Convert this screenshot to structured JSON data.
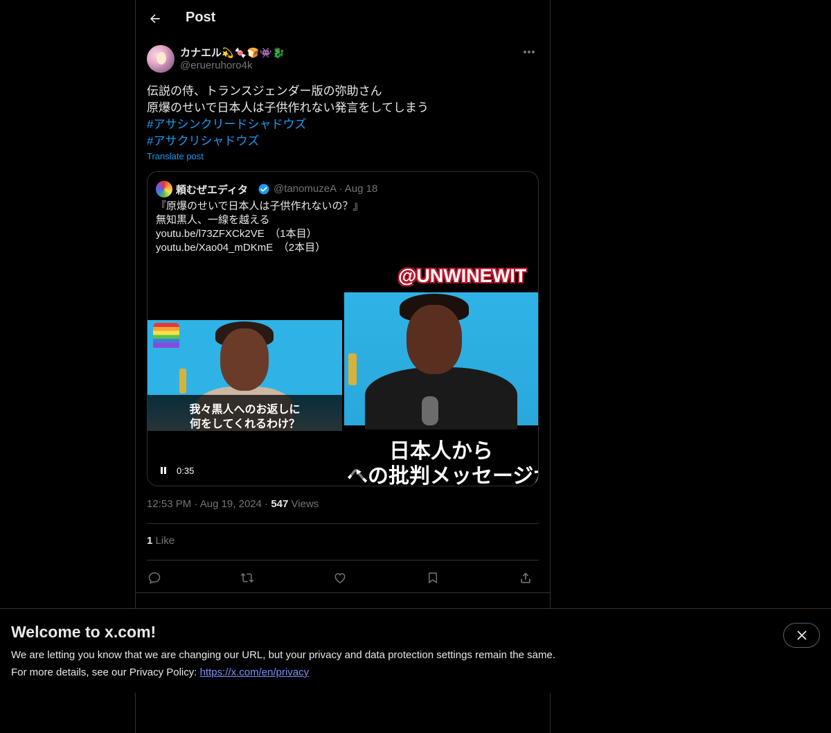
{
  "header": {
    "title": "Post"
  },
  "post": {
    "author_name": "カナエル",
    "author_emoji": "💫🍬🍞👾🐉",
    "author_handle": "@erueruhoro4k",
    "text_lines": [
      "伝説の侍、トランスジェンダー版の弥助さん",
      "原爆のせいで日本人は子供作れない発言をしてしまう"
    ],
    "hashtags": [
      "#アサシンクリードシャドウズ",
      "#アサクリシャドウズ"
    ],
    "translate_label": "Translate post",
    "time": "12:53 PM",
    "date": "Aug 19, 2024",
    "views_count": "547",
    "views_label": "Views",
    "likes_count": "1",
    "likes_label": "Like"
  },
  "quote": {
    "name": "頼むぜエディタ",
    "handle": "@tanomuzeA",
    "date": "Aug 18",
    "lines": [
      "『原爆のせいで日本人は子供作れないの？』",
      "無知黒人、一線を越える",
      "youtu.be/l73ZFXCk2VE　（1本目）",
      "youtu.be/Xao04_mDKmE　（2本目）"
    ],
    "video": {
      "left_caption_1": "我々黒人へのお返しに",
      "left_caption_2": "何をしてくれるわけ？",
      "right_top_text": "@UNWINEWIT",
      "right_caption_1": "日本人から",
      "right_caption_2": "への批判メッセージが",
      "time": "0:35"
    }
  },
  "banner": {
    "title": "Welcome to x.com!",
    "line1": "We are letting you know that we are changing our URL, but your privacy and data protection settings remain the same.",
    "line2_prefix": "For more details, see our Privacy Policy: ",
    "link": "https://x.com/en/privacy"
  },
  "colors": {
    "accent": "#1d9bf0",
    "border": "#2f3336",
    "muted": "#71767b",
    "link": "#7e8dfb"
  },
  "icons": [
    "back-arrow-icon",
    "more-icon",
    "verified-icon",
    "pause-icon",
    "play-icon",
    "reply-icon",
    "retweet-icon",
    "like-icon",
    "bookmark-icon",
    "share-icon",
    "close-icon"
  ]
}
